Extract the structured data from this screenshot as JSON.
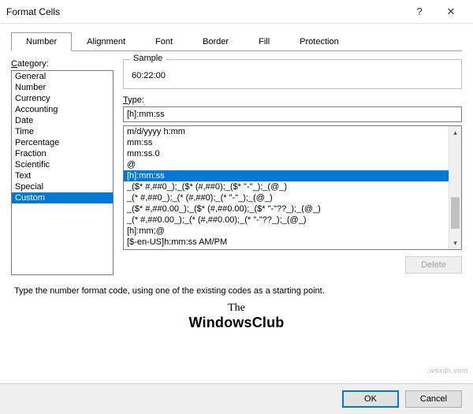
{
  "title": "Format Cells",
  "tabs": [
    "Number",
    "Alignment",
    "Font",
    "Border",
    "Fill",
    "Protection"
  ],
  "activeTab": 0,
  "categoryLabel": "Category:",
  "categories": [
    "General",
    "Number",
    "Currency",
    "Accounting",
    "Date",
    "Time",
    "Percentage",
    "Fraction",
    "Scientific",
    "Text",
    "Special",
    "Custom"
  ],
  "selectedCategory": 11,
  "sampleLabel": "Sample",
  "sampleValue": "60:22:00",
  "typeLabel": "Type:",
  "typeValue": "[h]:mm:ss",
  "typeList": [
    "m/d/yyyy h:mm",
    "mm:ss",
    "mm:ss.0",
    "@",
    "[h]:mm:ss",
    "_($* #,##0_);_($* (#,##0);_($* \"-\"_);_(@_)",
    "_(* #,##0_);_(* (#,##0);_(* \"-\"_);_(@_)",
    "_($* #,##0.00_);_($* (#,##0.00);_($* \"-\"??_);_(@_)",
    "_(* #,##0.00_);_(* (#,##0.00);_(* \"-\"??_);_(@_)",
    "[h]:mm;@",
    "[$-en-US]h:mm:ss AM/PM"
  ],
  "selectedTypeIndex": 4,
  "deleteLabel": "Delete",
  "hint": "Type the number format code, using one of the existing codes as a starting point.",
  "logo": {
    "line1": "The",
    "line2": "WindowsClub"
  },
  "okLabel": "OK",
  "cancelLabel": "Cancel",
  "watermark": ":wsxdn.com"
}
